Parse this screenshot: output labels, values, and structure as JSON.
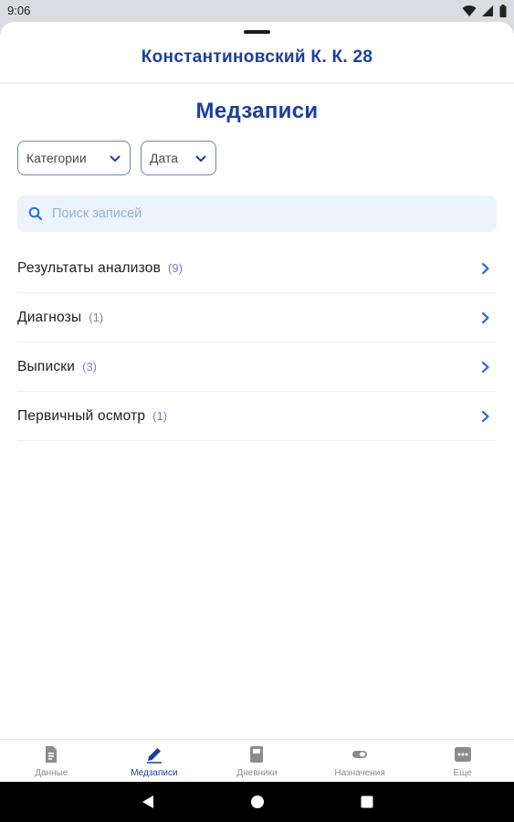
{
  "status_bar": {
    "time": "9:06"
  },
  "header": {
    "patient_name": "Константиновский К. К. 28"
  },
  "page": {
    "title": "Медзаписи"
  },
  "filters": {
    "category_label": "Категории",
    "date_label": "Дата"
  },
  "search": {
    "placeholder": "Поиск записей",
    "value": ""
  },
  "records": [
    {
      "label": "Результаты анализов",
      "count": "(9)"
    },
    {
      "label": "Диагнозы",
      "count": "(1)"
    },
    {
      "label": "Выписки",
      "count": "(3)"
    },
    {
      "label": "Первичный осмотр",
      "count": "(1)"
    }
  ],
  "tabs": [
    {
      "label": "Данные",
      "icon": "document-icon",
      "active": false
    },
    {
      "label": "Медзаписи",
      "icon": "pen-icon",
      "active": true
    },
    {
      "label": "Дневники",
      "icon": "book-icon",
      "active": false
    },
    {
      "label": "Назначения",
      "icon": "pill-icon",
      "active": false
    },
    {
      "label": "Еще",
      "icon": "more-icon",
      "active": false
    }
  ],
  "colors": {
    "brand": "#1c3f9c",
    "accent": "#2f6fd6",
    "count": "#6a86c8",
    "search_bg": "#edf3fc"
  }
}
